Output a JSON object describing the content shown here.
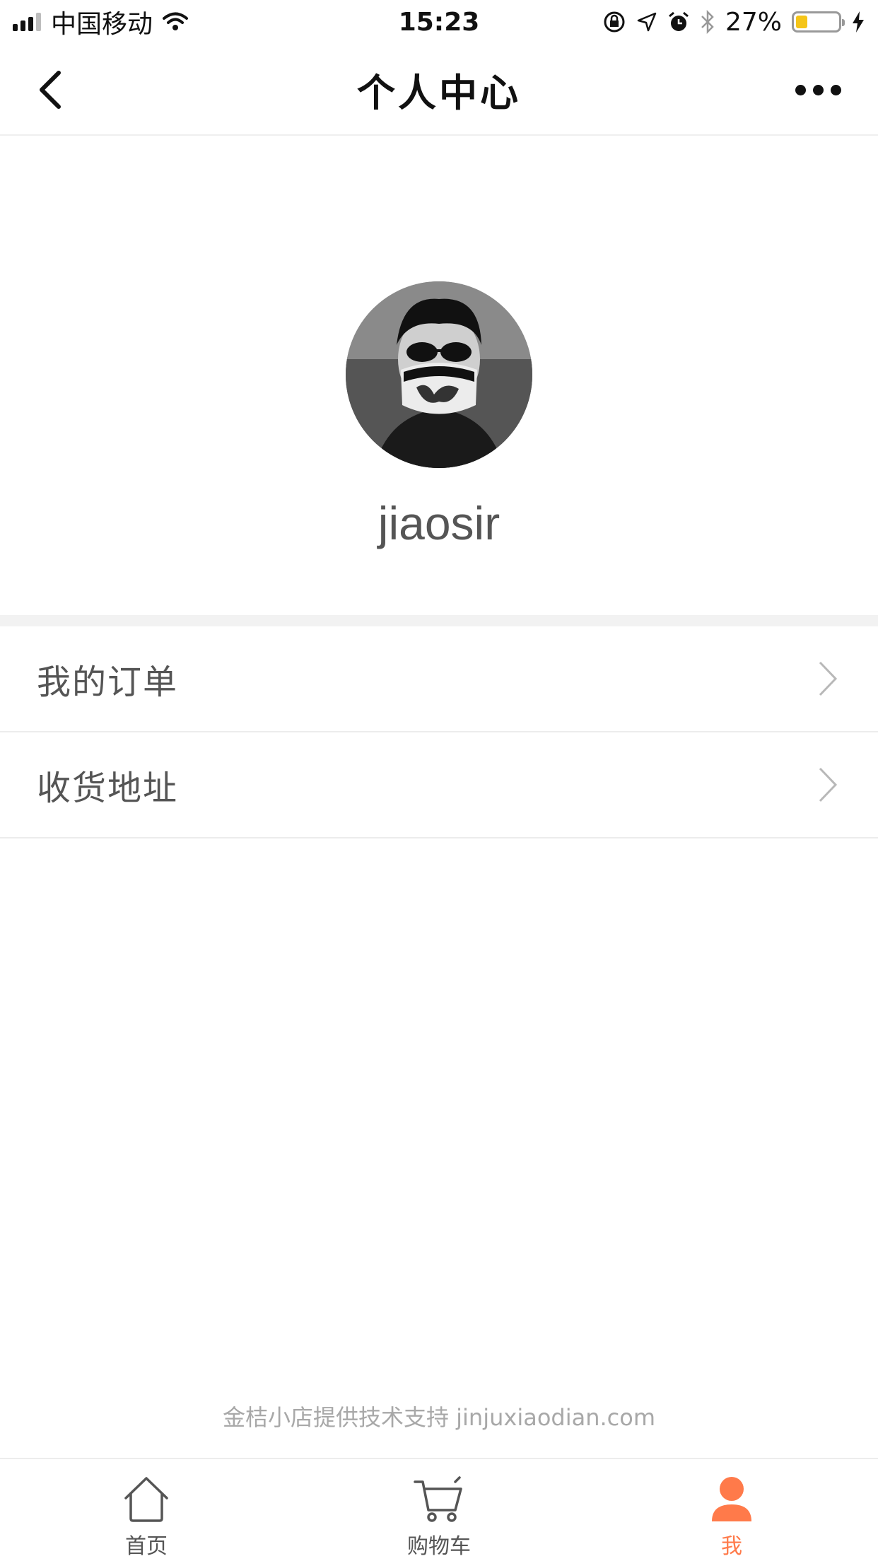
{
  "status_bar": {
    "carrier": "中国移动",
    "time": "15:23",
    "battery_percent": "27%",
    "battery_level": 0.27
  },
  "nav": {
    "title": "个人中心"
  },
  "profile": {
    "username": "jiaosir"
  },
  "menu": {
    "items": [
      {
        "label": "我的订单"
      },
      {
        "label": "收货地址"
      }
    ]
  },
  "footer": {
    "text": "金桔小店提供技术支持 jinjuxiaodian.com"
  },
  "tabs": [
    {
      "label": "首页",
      "icon": "home-icon",
      "active": false
    },
    {
      "label": "购物车",
      "icon": "cart-icon",
      "active": false
    },
    {
      "label": "我",
      "icon": "person-icon",
      "active": true
    }
  ],
  "colors": {
    "accent": "#ff7a4a",
    "battery": "#f5c518"
  }
}
